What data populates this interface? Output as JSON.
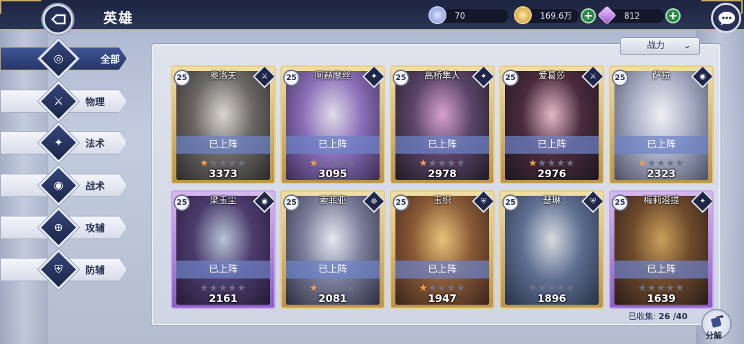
{
  "header": {
    "title": "英雄",
    "resources": [
      {
        "name": "energy",
        "icon": "energy-orb-icon",
        "value": "70"
      },
      {
        "name": "gold",
        "icon": "gold-coin-icon",
        "value": "169.6万"
      },
      {
        "name": "diamond",
        "icon": "diamond-icon",
        "value": "812"
      }
    ]
  },
  "sidebar": {
    "items": [
      {
        "label": "全部",
        "icon": "all-ring-icon",
        "active": true
      },
      {
        "label": "物理",
        "icon": "sword-icon",
        "active": false
      },
      {
        "label": "法术",
        "icon": "magic-icon",
        "active": false
      },
      {
        "label": "战术",
        "icon": "eye-icon",
        "active": false
      },
      {
        "label": "攻辅",
        "icon": "attack-support-icon",
        "active": false
      },
      {
        "label": "防辅",
        "icon": "shield-icon",
        "active": false
      }
    ]
  },
  "sort": {
    "label": "战力"
  },
  "heroes": [
    {
      "name": "奥洛夫",
      "level": "25",
      "status": "已上阵",
      "power": "3373",
      "stars": 1,
      "frame": "gold",
      "class_icon": "sword-icon",
      "art": [
        "#2c2a2a",
        "#6a6764",
        "#d9d6cf"
      ]
    },
    {
      "name": "阿赫摩丝",
      "level": "25",
      "status": "已上阵",
      "power": "3095",
      "stars": 1,
      "frame": "gold",
      "class_icon": "magic-icon",
      "art": [
        "#3b2a55",
        "#8a6fb8",
        "#e0dbe8"
      ]
    },
    {
      "name": "高桥隼人",
      "level": "25",
      "status": "已上阵",
      "power": "2978",
      "stars": 1,
      "frame": "gold",
      "class_icon": "magic-icon",
      "art": [
        "#201a26",
        "#5a4468",
        "#d6a0cc"
      ]
    },
    {
      "name": "爱葛莎",
      "level": "25",
      "status": "已上阵",
      "power": "2976",
      "stars": 1,
      "frame": "gold",
      "class_icon": "sword-icon",
      "art": [
        "#1d1520",
        "#4a2b3c",
        "#e3b8c6"
      ]
    },
    {
      "name": "萨拉",
      "level": "25",
      "status": "已上阵",
      "power": "2323",
      "stars": 1,
      "frame": "gold",
      "class_icon": "eye-icon",
      "art": [
        "#4a4f66",
        "#a7adc4",
        "#f0f1f6"
      ]
    },
    {
      "name": "梁玉尘",
      "level": "25",
      "status": "已上阵",
      "power": "2161",
      "stars": 0,
      "frame": "purple",
      "class_icon": "eye-icon",
      "art": [
        "#241b33",
        "#4c3c6e",
        "#b7c4d8"
      ]
    },
    {
      "name": "索菲亚",
      "level": "25",
      "status": "已上阵",
      "power": "2081",
      "stars": 1,
      "frame": "gold",
      "class_icon": "attack-support-icon",
      "art": [
        "#2b2d40",
        "#7b7e9a",
        "#e6e8f1"
      ]
    },
    {
      "name": "玉织",
      "level": "25",
      "status": "已上阵",
      "power": "1947",
      "stars": 1,
      "frame": "gold",
      "class_icon": "shield-icon",
      "art": [
        "#3a241c",
        "#8a5a36",
        "#e8c27a"
      ]
    },
    {
      "name": "瑟琳",
      "level": "25",
      "status": "",
      "power": "1896",
      "stars": 0,
      "frame": "gold",
      "class_icon": "shield-icon",
      "art": [
        "#263248",
        "#5f6f92",
        "#d8dcdf"
      ]
    },
    {
      "name": "梅莉塔提",
      "level": "25",
      "status": "已上阵",
      "power": "1639",
      "stars": 0,
      "frame": "purple",
      "class_icon": "magic-icon",
      "art": [
        "#2a1c18",
        "#6e4a2c",
        "#c9a05a"
      ]
    }
  ],
  "collected": {
    "label": "已收集:",
    "value": "26 /40"
  },
  "decompose": {
    "label": "分解"
  }
}
